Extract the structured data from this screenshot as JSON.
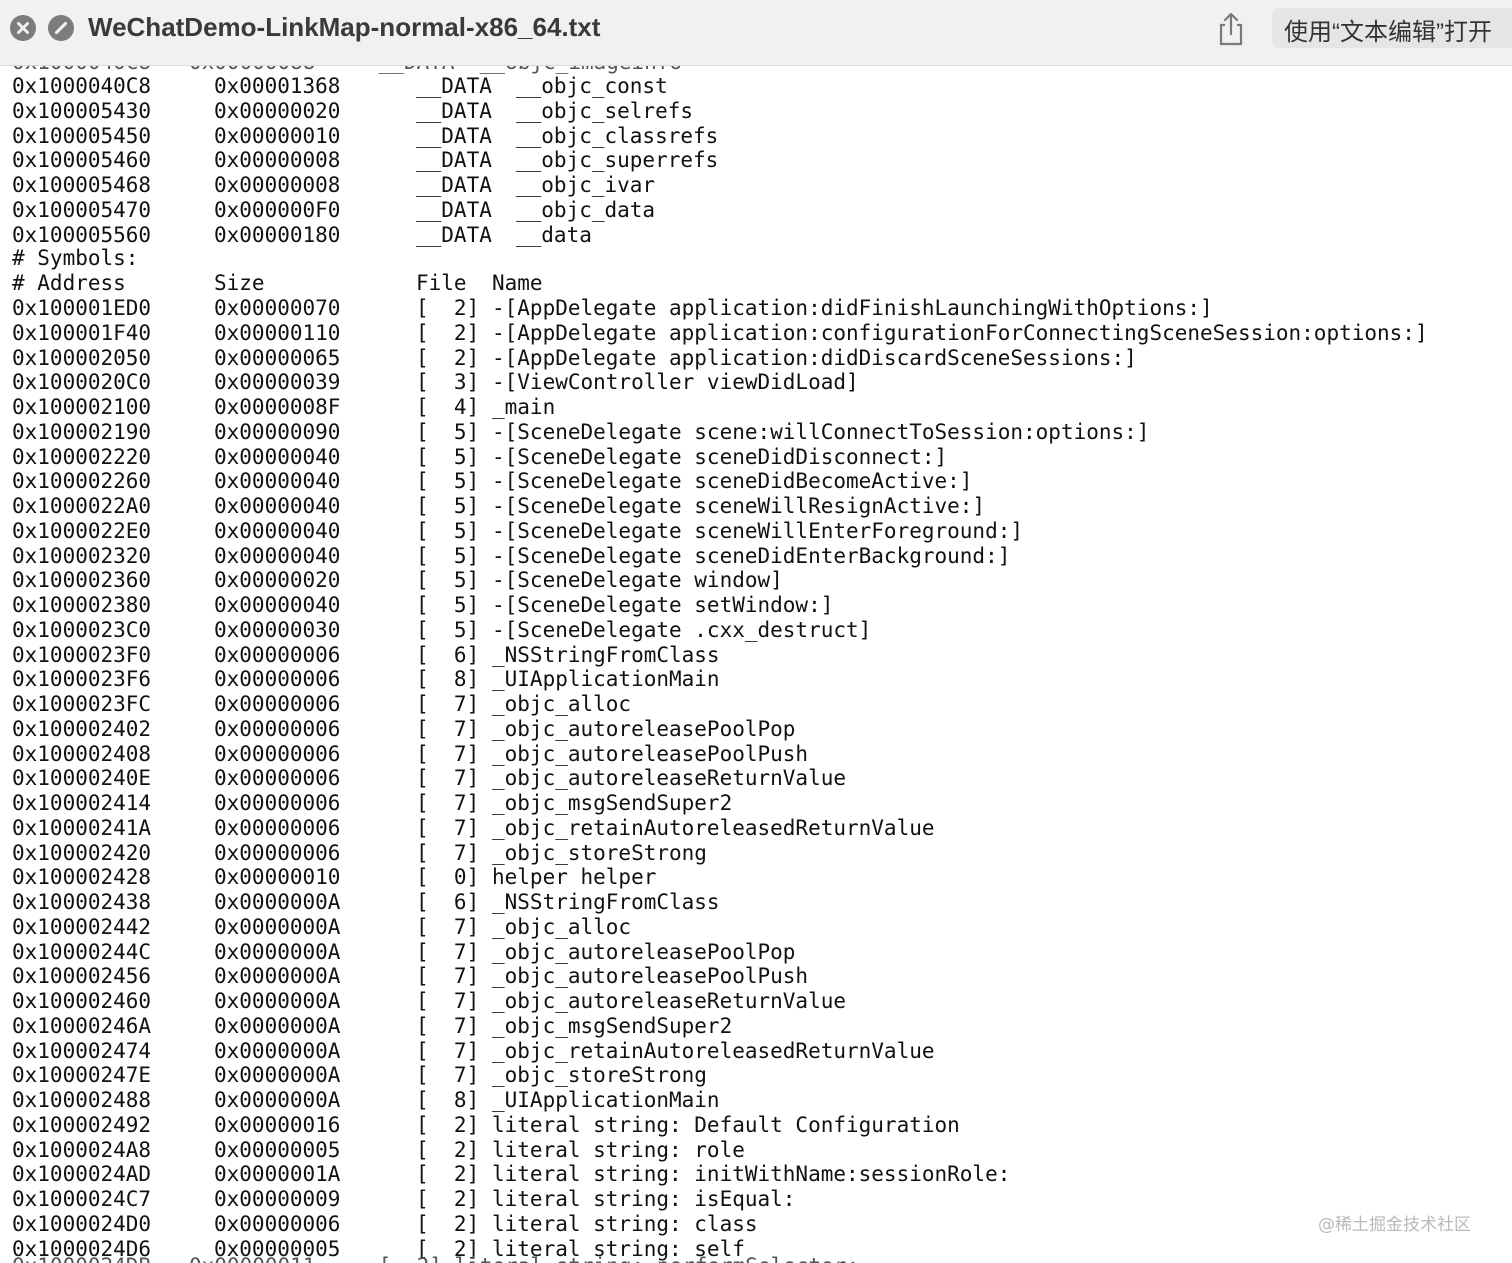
{
  "window": {
    "title": "WeChatDemo-LinkMap-normal-x86_64.txt",
    "open_with_label": "使用“文本编辑”打开"
  },
  "icons": [
    "close-icon",
    "minimize-icon",
    "share-icon"
  ],
  "sections": [
    {
      "address": "0x1000040C8",
      "size": "0x00001368",
      "segment": "__DATA",
      "section": "__objc_const"
    },
    {
      "address": "0x100005430",
      "size": "0x00000020",
      "segment": "__DATA",
      "section": "__objc_selrefs"
    },
    {
      "address": "0x100005450",
      "size": "0x00000010",
      "segment": "__DATA",
      "section": "__objc_classrefs"
    },
    {
      "address": "0x100005460",
      "size": "0x00000008",
      "segment": "__DATA",
      "section": "__objc_superrefs"
    },
    {
      "address": "0x100005468",
      "size": "0x00000008",
      "segment": "__DATA",
      "section": "__objc_ivar"
    },
    {
      "address": "0x100005470",
      "size": "0x000000F0",
      "segment": "__DATA",
      "section": "__objc_data"
    },
    {
      "address": "0x100005560",
      "size": "0x00000180",
      "segment": "__DATA",
      "section": "__data"
    }
  ],
  "symbols_header": "# Symbols:",
  "columns": {
    "address": "# Address",
    "size": "Size",
    "file": "File",
    "name": "Name"
  },
  "symbols": [
    {
      "address": "0x100001ED0",
      "size": "0x00000070",
      "file": "[  2]",
      "name": "-[AppDelegate application:didFinishLaunchingWithOptions:]"
    },
    {
      "address": "0x100001F40",
      "size": "0x00000110",
      "file": "[  2]",
      "name": "-[AppDelegate application:configurationForConnectingSceneSession:options:]"
    },
    {
      "address": "0x100002050",
      "size": "0x00000065",
      "file": "[  2]",
      "name": "-[AppDelegate application:didDiscardSceneSessions:]"
    },
    {
      "address": "0x1000020C0",
      "size": "0x00000039",
      "file": "[  3]",
      "name": "-[ViewController viewDidLoad]"
    },
    {
      "address": "0x100002100",
      "size": "0x0000008F",
      "file": "[  4]",
      "name": "_main"
    },
    {
      "address": "0x100002190",
      "size": "0x00000090",
      "file": "[  5]",
      "name": "-[SceneDelegate scene:willConnectToSession:options:]"
    },
    {
      "address": "0x100002220",
      "size": "0x00000040",
      "file": "[  5]",
      "name": "-[SceneDelegate sceneDidDisconnect:]"
    },
    {
      "address": "0x100002260",
      "size": "0x00000040",
      "file": "[  5]",
      "name": "-[SceneDelegate sceneDidBecomeActive:]"
    },
    {
      "address": "0x1000022A0",
      "size": "0x00000040",
      "file": "[  5]",
      "name": "-[SceneDelegate sceneWillResignActive:]"
    },
    {
      "address": "0x1000022E0",
      "size": "0x00000040",
      "file": "[  5]",
      "name": "-[SceneDelegate sceneWillEnterForeground:]"
    },
    {
      "address": "0x100002320",
      "size": "0x00000040",
      "file": "[  5]",
      "name": "-[SceneDelegate sceneDidEnterBackground:]"
    },
    {
      "address": "0x100002360",
      "size": "0x00000020",
      "file": "[  5]",
      "name": "-[SceneDelegate window]"
    },
    {
      "address": "0x100002380",
      "size": "0x00000040",
      "file": "[  5]",
      "name": "-[SceneDelegate setWindow:]"
    },
    {
      "address": "0x1000023C0",
      "size": "0x00000030",
      "file": "[  5]",
      "name": "-[SceneDelegate .cxx_destruct]"
    },
    {
      "address": "0x1000023F0",
      "size": "0x00000006",
      "file": "[  6]",
      "name": "_NSStringFromClass"
    },
    {
      "address": "0x1000023F6",
      "size": "0x00000006",
      "file": "[  8]",
      "name": "_UIApplicationMain"
    },
    {
      "address": "0x1000023FC",
      "size": "0x00000006",
      "file": "[  7]",
      "name": "_objc_alloc"
    },
    {
      "address": "0x100002402",
      "size": "0x00000006",
      "file": "[  7]",
      "name": "_objc_autoreleasePoolPop"
    },
    {
      "address": "0x100002408",
      "size": "0x00000006",
      "file": "[  7]",
      "name": "_objc_autoreleasePoolPush"
    },
    {
      "address": "0x10000240E",
      "size": "0x00000006",
      "file": "[  7]",
      "name": "_objc_autoreleaseReturnValue"
    },
    {
      "address": "0x100002414",
      "size": "0x00000006",
      "file": "[  7]",
      "name": "_objc_msgSendSuper2"
    },
    {
      "address": "0x10000241A",
      "size": "0x00000006",
      "file": "[  7]",
      "name": "_objc_retainAutoreleasedReturnValue"
    },
    {
      "address": "0x100002420",
      "size": "0x00000006",
      "file": "[  7]",
      "name": "_objc_storeStrong"
    },
    {
      "address": "0x100002428",
      "size": "0x00000010",
      "file": "[  0]",
      "name": "helper helper"
    },
    {
      "address": "0x100002438",
      "size": "0x0000000A",
      "file": "[  6]",
      "name": "_NSStringFromClass"
    },
    {
      "address": "0x100002442",
      "size": "0x0000000A",
      "file": "[  7]",
      "name": "_objc_alloc"
    },
    {
      "address": "0x10000244C",
      "size": "0x0000000A",
      "file": "[  7]",
      "name": "_objc_autoreleasePoolPop"
    },
    {
      "address": "0x100002456",
      "size": "0x0000000A",
      "file": "[  7]",
      "name": "_objc_autoreleasePoolPush"
    },
    {
      "address": "0x100002460",
      "size": "0x0000000A",
      "file": "[  7]",
      "name": "_objc_autoreleaseReturnValue"
    },
    {
      "address": "0x10000246A",
      "size": "0x0000000A",
      "file": "[  7]",
      "name": "_objc_msgSendSuper2"
    },
    {
      "address": "0x100002474",
      "size": "0x0000000A",
      "file": "[  7]",
      "name": "_objc_retainAutoreleasedReturnValue"
    },
    {
      "address": "0x10000247E",
      "size": "0x0000000A",
      "file": "[  7]",
      "name": "_objc_storeStrong"
    },
    {
      "address": "0x100002488",
      "size": "0x0000000A",
      "file": "[  8]",
      "name": "_UIApplicationMain"
    },
    {
      "address": "0x100002492",
      "size": "0x00000016",
      "file": "[  2]",
      "name": "literal string: Default Configuration"
    },
    {
      "address": "0x1000024A8",
      "size": "0x00000005",
      "file": "[  2]",
      "name": "literal string: role"
    },
    {
      "address": "0x1000024AD",
      "size": "0x0000001A",
      "file": "[  2]",
      "name": "literal string: initWithName:sessionRole:"
    },
    {
      "address": "0x1000024C7",
      "size": "0x00000009",
      "file": "[  2]",
      "name": "literal string: isEqual:"
    },
    {
      "address": "0x1000024D0",
      "size": "0x00000006",
      "file": "[  2]",
      "name": "literal string: class"
    },
    {
      "address": "0x1000024D6",
      "size": "0x00000005",
      "file": "[  2]",
      "name": "literal string: self"
    }
  ],
  "watermark": "@稀土掘金技术社区"
}
